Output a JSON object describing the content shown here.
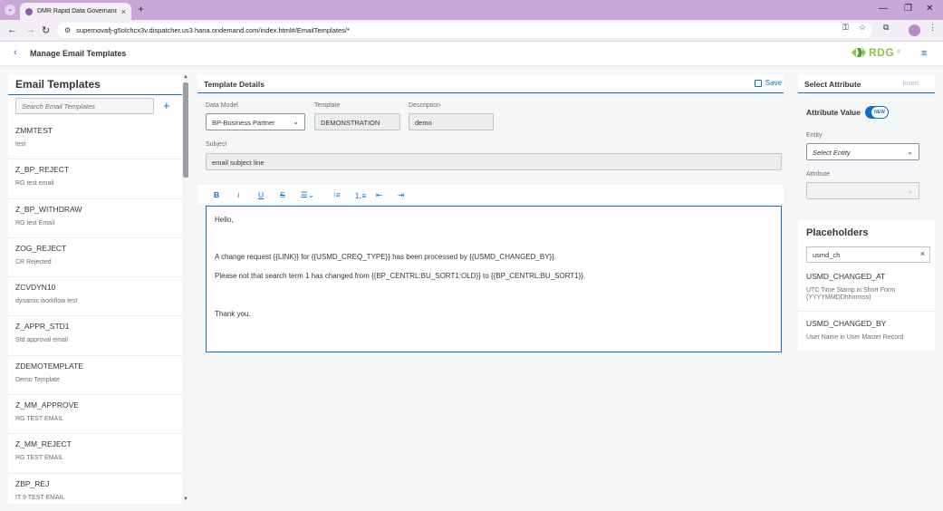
{
  "browser": {
    "tab_title": "DMR Rapid Data Governance",
    "url": "supernovafj-g5olchcx3v.dispatcher.us3.hana.ondemand.com/index.html#/EmailTemplates/*"
  },
  "app": {
    "title": "Manage Email Templates",
    "logo_text": "RDG",
    "logo_mark": "®"
  },
  "left": {
    "title": "Email Templates",
    "search_placeholder": "Search Email Templates",
    "items": [
      {
        "name": "ZMMTEST",
        "desc": "test"
      },
      {
        "name": "Z_BP_REJECT",
        "desc": "RG test email"
      },
      {
        "name": "Z_BP_WITHDRAW",
        "desc": "RG test Email"
      },
      {
        "name": "ZOG_REJECT",
        "desc": "CR Rejected"
      },
      {
        "name": "ZCVDYN10",
        "desc": "dynamic workflow test"
      },
      {
        "name": "Z_APPR_STD1",
        "desc": "Std approval email"
      },
      {
        "name": "ZDEMOTEMPLATE",
        "desc": "Demo Template"
      },
      {
        "name": "Z_MM_APPROVE",
        "desc": "RG TEST EMAIL"
      },
      {
        "name": "Z_MM_REJECT",
        "desc": "RG TEST EMAIL"
      },
      {
        "name": "ZBP_REJ",
        "desc": "IT 9 TEST EMAIL"
      }
    ]
  },
  "details": {
    "title": "Template Details",
    "save_label": "Save",
    "data_model_label": "Data Model",
    "data_model_value": "BP-Business Partner",
    "template_label": "Template",
    "template_value": "DEMONSTRATION",
    "description_label": "Description",
    "description_value": "demo",
    "subject_label": "Subject",
    "subject_value": "email subject line",
    "body": [
      "Hello,",
      "A change request {{LINK}} for {{USMD_CREQ_TYPE}} has been processed by {{USMD_CHANGED_BY}}.",
      "Please not that search term 1 has changed from {{BP_CENTRL:BU_SORT1:OLD}} to {{BP_CENTRL:BU_SORT1}}.",
      "Thank you."
    ]
  },
  "attribute": {
    "title": "Select Attribute",
    "insert_label": "Insert",
    "attribute_value_label": "Attribute Value",
    "toggle_text": "NEW",
    "entity_label": "Entity",
    "entity_placeholder": "Select Entity",
    "attribute_label": "Attribute"
  },
  "placeholders": {
    "title": "Placeholders",
    "search_value": "usmd_ch",
    "items": [
      {
        "name": "USMD_CHANGED_AT",
        "desc": "UTC Time Stamp in Short Form (YYYYMMDDhhmmss)"
      },
      {
        "name": "USMD_CHANGED_BY",
        "desc": "User Name in User Master Record"
      }
    ]
  }
}
